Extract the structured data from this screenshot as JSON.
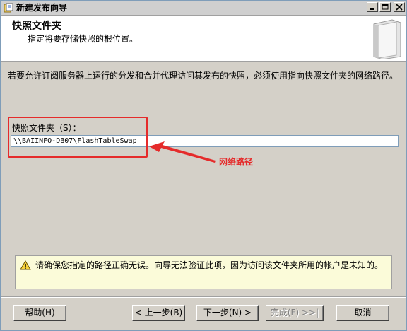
{
  "window": {
    "title": "新建发布向导"
  },
  "header": {
    "title": "快照文件夹",
    "subtitle": "指定将要存储快照的根位置。"
  },
  "main": {
    "description": "若要允许订阅服务器上运行的分发和合并代理访问其发布的快照，必须使用指向快照文件夹的网络路径。",
    "folder_label": "快照文件夹（S）：",
    "folder_value": "\\\\BAIINFO-DB07\\FlashTableSwap",
    "annotation": "网络路径",
    "warning": "请确保您指定的路径正确无误。向导无法验证此项，因为访问该文件夹所用的帐户是未知的。"
  },
  "buttons": {
    "help": "帮助(H)",
    "back": "< 上一步(B)",
    "next": "下一步(N) >",
    "finish": "完成(F) >>|",
    "cancel": "取消"
  },
  "colors": {
    "annotation": "#e52b2b",
    "dialog_bg": "#d4d0c8",
    "warning_bg": "#fbfbd9"
  },
  "icons": {
    "title": "wizard-app-icon",
    "warning": "warning-triangle-icon",
    "header_art": "document-stack-icon"
  }
}
